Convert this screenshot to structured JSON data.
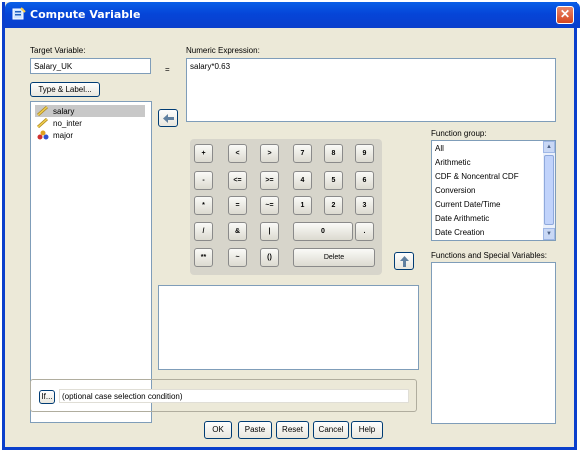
{
  "window": {
    "title": "Compute Variable",
    "close_label": "✕"
  },
  "target": {
    "label": "Target Variable:",
    "value": "Salary_UK",
    "equals": "="
  },
  "type_label_button": "Type & Label...",
  "expression": {
    "label": "Numeric Expression:",
    "value": "salary*0.63"
  },
  "variables": [
    "salary",
    "no_inter",
    "major"
  ],
  "calculator": {
    "keys": [
      "+",
      "<",
      ">",
      "7",
      "8",
      "9",
      "-",
      "<=",
      ">=",
      "4",
      "5",
      "6",
      "*",
      "=",
      "~=",
      "1",
      "2",
      "3",
      "/",
      "&",
      "|",
      "0",
      ".",
      "**",
      "~",
      "()",
      "Delete"
    ]
  },
  "function_group": {
    "label": "Function group:",
    "items": [
      "All",
      "Arithmetic",
      "CDF & Noncentral CDF",
      "Conversion",
      "Current Date/Time",
      "Date Arithmetic",
      "Date Creation"
    ]
  },
  "functions_label": "Functions and Special Variables:",
  "if_button": "If...",
  "if_text": "(optional case selection condition)",
  "buttons": {
    "ok": "OK",
    "paste": "Paste",
    "reset": "Reset",
    "cancel": "Cancel",
    "help": "Help"
  },
  "colors": {
    "title_bar": "#0a3fcc",
    "dialog_bg": "#ece9d8",
    "selection": "#c8c8c8"
  }
}
